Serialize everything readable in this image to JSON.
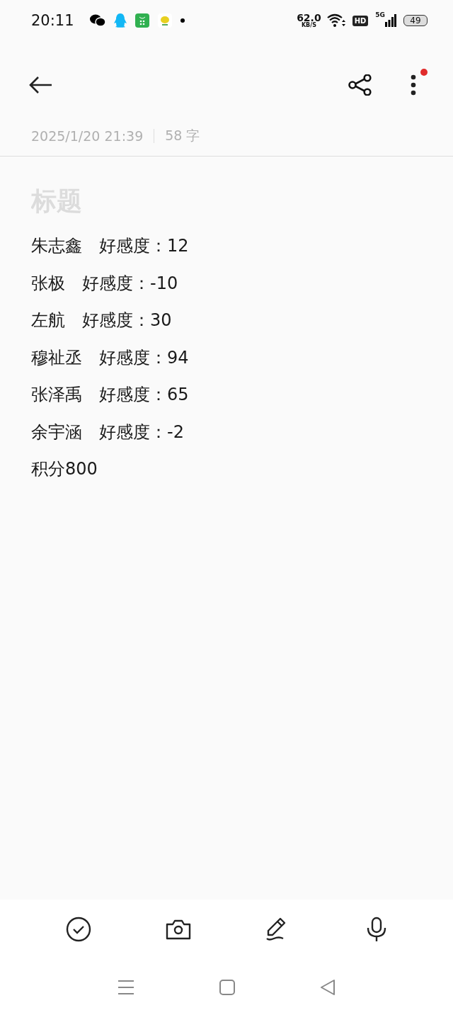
{
  "status_bar": {
    "time": "20:11",
    "network_speed": "62.0",
    "network_speed_unit": "KB/S",
    "hd_label": "HD",
    "network_type": "5G",
    "battery": "49"
  },
  "toolbar": {
    "menu_badge": true
  },
  "meta": {
    "date": "2025/1/20 21:39",
    "word_count": "58 字"
  },
  "note": {
    "title": {
      "placeholder": "标题"
    },
    "lines": [
      "朱志鑫　好感度：12",
      "张极　好感度：-10",
      "左航　好感度：30",
      "穆祉丞　好感度：94",
      "张泽禹　好感度：65",
      "余宇涵　好感度：-2",
      "积分800"
    ]
  }
}
